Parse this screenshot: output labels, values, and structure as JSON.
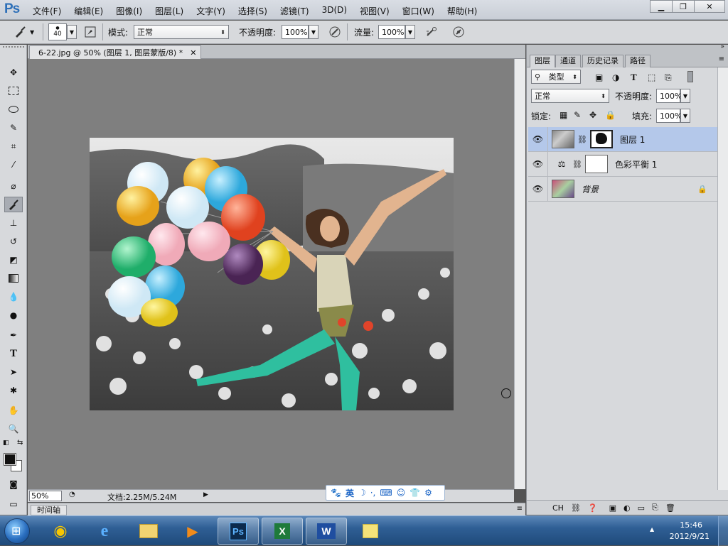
{
  "app": {
    "logo": "Ps"
  },
  "menu": [
    "文件(F)",
    "编辑(E)",
    "图像(I)",
    "图层(L)",
    "文字(Y)",
    "选择(S)",
    "滤镜(T)",
    "3D(D)",
    "视图(V)",
    "窗口(W)",
    "帮助(H)"
  ],
  "options": {
    "brush_size": "40",
    "mode_label": "模式:",
    "mode_value": "正常",
    "opacity_label": "不透明度:",
    "opacity_value": "100%",
    "flow_label": "流量:",
    "flow_value": "100%"
  },
  "document": {
    "tab_title": "6-22.jpg @ 50% (图层 1, 图层蒙版/8) *",
    "zoom": "50%",
    "doc_info": "文档:2.25M/5.24M"
  },
  "timeline_label": "时间轴",
  "ime": {
    "lang": "英"
  },
  "panel": {
    "tabs": [
      "图层",
      "通道",
      "历史记录",
      "路径"
    ],
    "filter_kind": "类型",
    "blend_mode": "正常",
    "opacity_label": "不透明度:",
    "opacity_value": "100%",
    "lock_label": "锁定:",
    "fill_label": "填充:",
    "fill_value": "100%",
    "layers": [
      {
        "name": "图层 1",
        "selected": true
      },
      {
        "name": "色彩平衡 1",
        "selected": false
      },
      {
        "name": "背景",
        "selected": false
      }
    ],
    "footer_label": "CH"
  },
  "taskbar": {
    "time": "15:46",
    "date": "2012/9/21"
  },
  "colors": {
    "accent": "#2d6fb8",
    "selected_layer": "#b4c8ea"
  }
}
